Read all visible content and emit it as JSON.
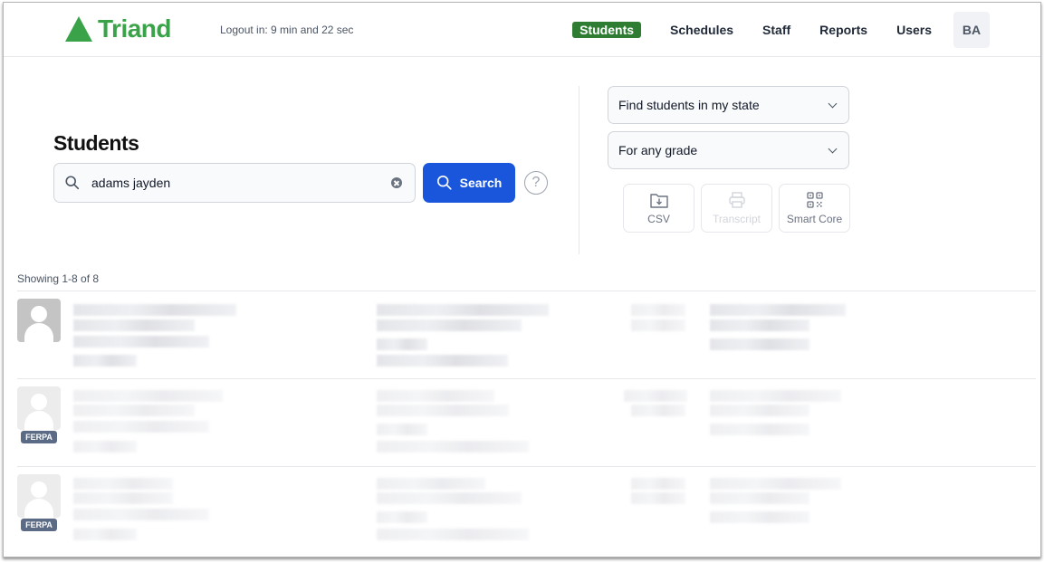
{
  "header": {
    "brand": "Triand",
    "logout_text": "Logout in: 9 min and 22 sec",
    "nav": [
      {
        "label": "Students",
        "active": true
      },
      {
        "label": "Schedules",
        "active": false
      },
      {
        "label": "Staff",
        "active": false
      },
      {
        "label": "Reports",
        "active": false
      },
      {
        "label": "Users",
        "active": false
      }
    ],
    "user_initials": "BA"
  },
  "search": {
    "title": "Students",
    "query": "adams jayden",
    "button_label": "Search",
    "help_symbol": "?"
  },
  "filters": {
    "scope": "Find students in my state",
    "grade": "For any grade"
  },
  "actions": [
    {
      "label": "CSV",
      "icon": "folder-download-icon",
      "enabled": true
    },
    {
      "label": "Transcript",
      "icon": "printer-icon",
      "enabled": false
    },
    {
      "label": "Smart Core",
      "icon": "qr-code-icon",
      "enabled": true
    }
  ],
  "results": {
    "summary": "Showing 1-8 of 8",
    "rows": [
      {
        "ferpa": false,
        "badge": "",
        "redacted": true
      },
      {
        "ferpa": true,
        "badge": "FERPA",
        "redacted": true
      },
      {
        "ferpa": true,
        "badge": "FERPA",
        "redacted": true
      }
    ]
  },
  "colors": {
    "brand": "#3aa34a",
    "nav_active": "#2e7d32",
    "primary_button": "#1a56db",
    "ferpa_badge": "#5b6b85"
  }
}
